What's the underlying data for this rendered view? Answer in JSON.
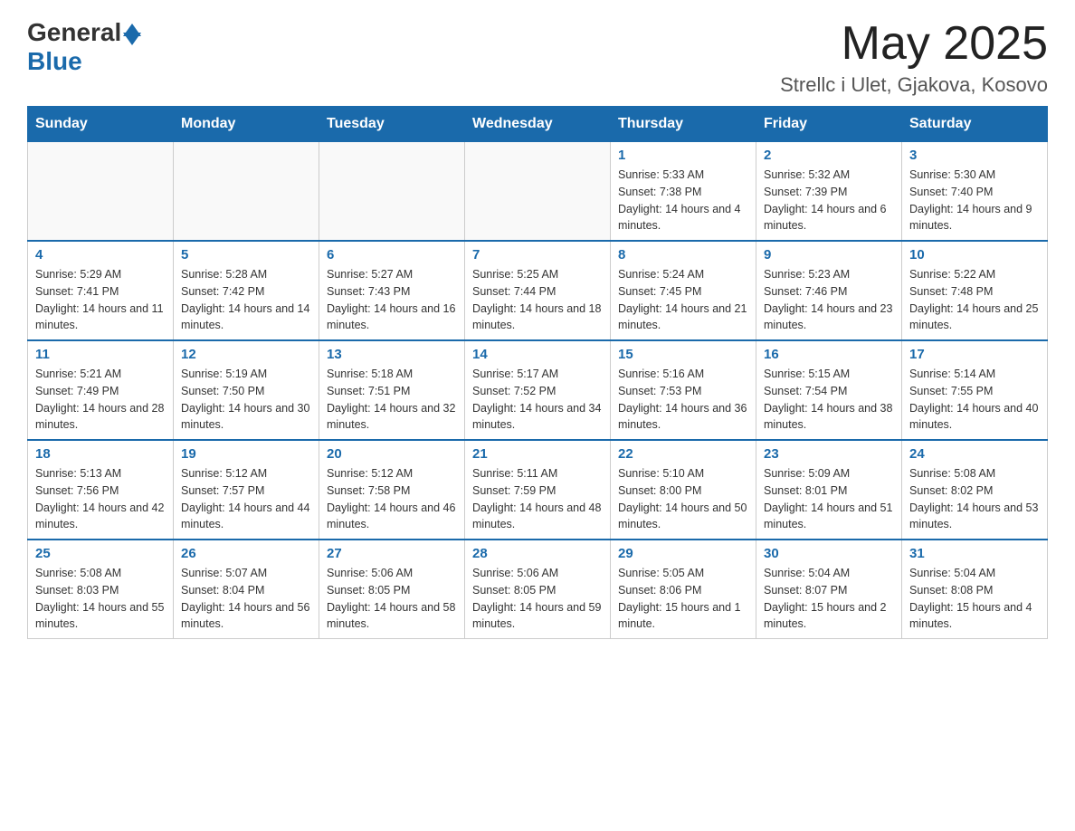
{
  "header": {
    "logo_general": "General",
    "logo_blue": "Blue",
    "month": "May 2025",
    "location": "Strellc i Ulet, Gjakova, Kosovo"
  },
  "days_of_week": [
    "Sunday",
    "Monday",
    "Tuesday",
    "Wednesday",
    "Thursday",
    "Friday",
    "Saturday"
  ],
  "weeks": [
    [
      {
        "day": "",
        "info": ""
      },
      {
        "day": "",
        "info": ""
      },
      {
        "day": "",
        "info": ""
      },
      {
        "day": "",
        "info": ""
      },
      {
        "day": "1",
        "info": "Sunrise: 5:33 AM\nSunset: 7:38 PM\nDaylight: 14 hours and 4 minutes."
      },
      {
        "day": "2",
        "info": "Sunrise: 5:32 AM\nSunset: 7:39 PM\nDaylight: 14 hours and 6 minutes."
      },
      {
        "day": "3",
        "info": "Sunrise: 5:30 AM\nSunset: 7:40 PM\nDaylight: 14 hours and 9 minutes."
      }
    ],
    [
      {
        "day": "4",
        "info": "Sunrise: 5:29 AM\nSunset: 7:41 PM\nDaylight: 14 hours and 11 minutes."
      },
      {
        "day": "5",
        "info": "Sunrise: 5:28 AM\nSunset: 7:42 PM\nDaylight: 14 hours and 14 minutes."
      },
      {
        "day": "6",
        "info": "Sunrise: 5:27 AM\nSunset: 7:43 PM\nDaylight: 14 hours and 16 minutes."
      },
      {
        "day": "7",
        "info": "Sunrise: 5:25 AM\nSunset: 7:44 PM\nDaylight: 14 hours and 18 minutes."
      },
      {
        "day": "8",
        "info": "Sunrise: 5:24 AM\nSunset: 7:45 PM\nDaylight: 14 hours and 21 minutes."
      },
      {
        "day": "9",
        "info": "Sunrise: 5:23 AM\nSunset: 7:46 PM\nDaylight: 14 hours and 23 minutes."
      },
      {
        "day": "10",
        "info": "Sunrise: 5:22 AM\nSunset: 7:48 PM\nDaylight: 14 hours and 25 minutes."
      }
    ],
    [
      {
        "day": "11",
        "info": "Sunrise: 5:21 AM\nSunset: 7:49 PM\nDaylight: 14 hours and 28 minutes."
      },
      {
        "day": "12",
        "info": "Sunrise: 5:19 AM\nSunset: 7:50 PM\nDaylight: 14 hours and 30 minutes."
      },
      {
        "day": "13",
        "info": "Sunrise: 5:18 AM\nSunset: 7:51 PM\nDaylight: 14 hours and 32 minutes."
      },
      {
        "day": "14",
        "info": "Sunrise: 5:17 AM\nSunset: 7:52 PM\nDaylight: 14 hours and 34 minutes."
      },
      {
        "day": "15",
        "info": "Sunrise: 5:16 AM\nSunset: 7:53 PM\nDaylight: 14 hours and 36 minutes."
      },
      {
        "day": "16",
        "info": "Sunrise: 5:15 AM\nSunset: 7:54 PM\nDaylight: 14 hours and 38 minutes."
      },
      {
        "day": "17",
        "info": "Sunrise: 5:14 AM\nSunset: 7:55 PM\nDaylight: 14 hours and 40 minutes."
      }
    ],
    [
      {
        "day": "18",
        "info": "Sunrise: 5:13 AM\nSunset: 7:56 PM\nDaylight: 14 hours and 42 minutes."
      },
      {
        "day": "19",
        "info": "Sunrise: 5:12 AM\nSunset: 7:57 PM\nDaylight: 14 hours and 44 minutes."
      },
      {
        "day": "20",
        "info": "Sunrise: 5:12 AM\nSunset: 7:58 PM\nDaylight: 14 hours and 46 minutes."
      },
      {
        "day": "21",
        "info": "Sunrise: 5:11 AM\nSunset: 7:59 PM\nDaylight: 14 hours and 48 minutes."
      },
      {
        "day": "22",
        "info": "Sunrise: 5:10 AM\nSunset: 8:00 PM\nDaylight: 14 hours and 50 minutes."
      },
      {
        "day": "23",
        "info": "Sunrise: 5:09 AM\nSunset: 8:01 PM\nDaylight: 14 hours and 51 minutes."
      },
      {
        "day": "24",
        "info": "Sunrise: 5:08 AM\nSunset: 8:02 PM\nDaylight: 14 hours and 53 minutes."
      }
    ],
    [
      {
        "day": "25",
        "info": "Sunrise: 5:08 AM\nSunset: 8:03 PM\nDaylight: 14 hours and 55 minutes."
      },
      {
        "day": "26",
        "info": "Sunrise: 5:07 AM\nSunset: 8:04 PM\nDaylight: 14 hours and 56 minutes."
      },
      {
        "day": "27",
        "info": "Sunrise: 5:06 AM\nSunset: 8:05 PM\nDaylight: 14 hours and 58 minutes."
      },
      {
        "day": "28",
        "info": "Sunrise: 5:06 AM\nSunset: 8:05 PM\nDaylight: 14 hours and 59 minutes."
      },
      {
        "day": "29",
        "info": "Sunrise: 5:05 AM\nSunset: 8:06 PM\nDaylight: 15 hours and 1 minute."
      },
      {
        "day": "30",
        "info": "Sunrise: 5:04 AM\nSunset: 8:07 PM\nDaylight: 15 hours and 2 minutes."
      },
      {
        "day": "31",
        "info": "Sunrise: 5:04 AM\nSunset: 8:08 PM\nDaylight: 15 hours and 4 minutes."
      }
    ]
  ]
}
